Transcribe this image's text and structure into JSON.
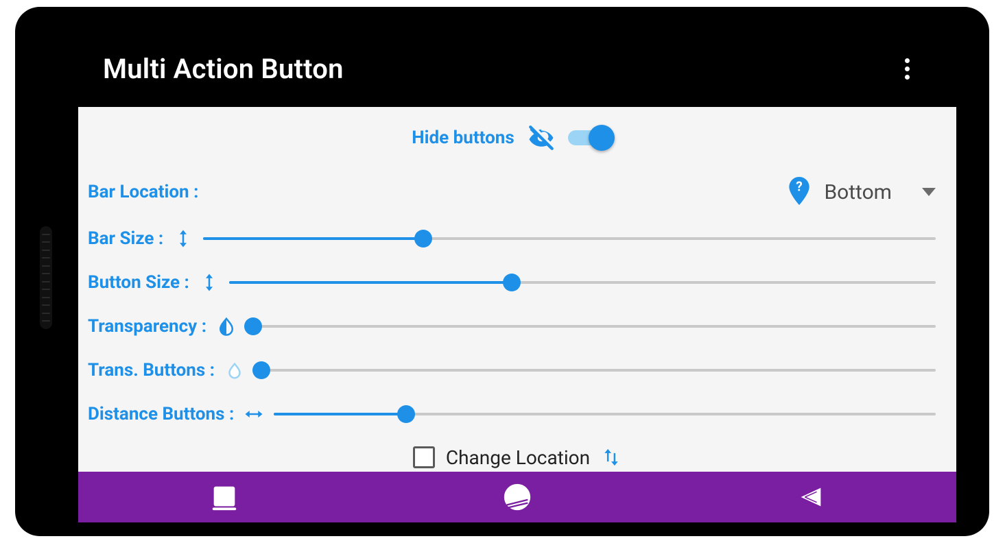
{
  "appbar": {
    "title": "Multi Action Button"
  },
  "hide": {
    "label": "Hide buttons",
    "enabled": true
  },
  "barLocation": {
    "label": "Bar Location :",
    "value": "Bottom"
  },
  "sliders": {
    "barSize": {
      "label": "Bar Size :",
      "value": 30
    },
    "buttonSize": {
      "label": "Button Size :",
      "value": 40
    },
    "transparency": {
      "label": "Transparency :",
      "value": 1
    },
    "transButtons": {
      "label": "Trans. Buttons :",
      "value": 1
    },
    "distanceButtons": {
      "label": "Distance Buttons :",
      "value": 20
    }
  },
  "changeLocation": {
    "label": "Change Location",
    "checked": false
  },
  "colors": {
    "accent": "#1e90e8",
    "nav": "#7b1fa2"
  }
}
